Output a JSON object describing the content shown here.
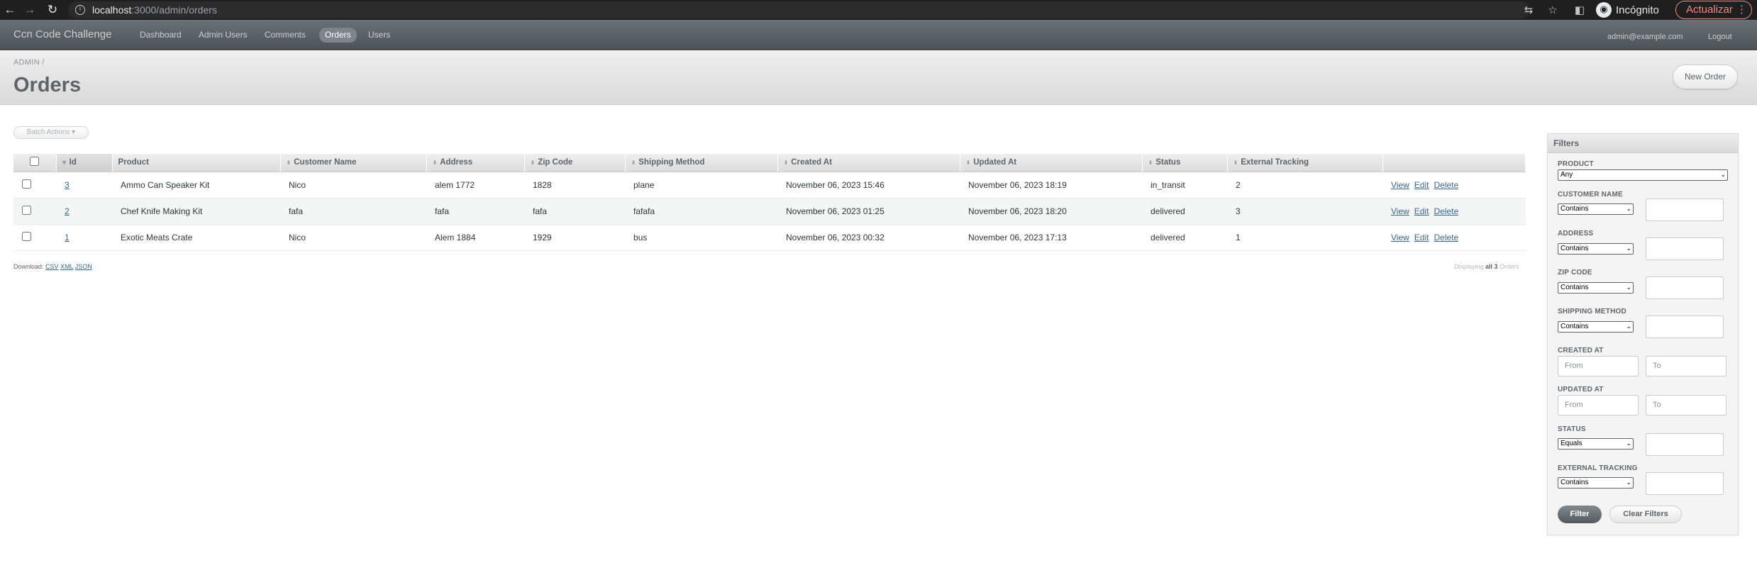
{
  "browser": {
    "url_host": "localhost",
    "url_path": ":3000/admin/orders",
    "incognito_label": "Incógnito",
    "update_label": "Actualizar"
  },
  "header": {
    "site_title": "Ccn Code Challenge",
    "tabs": [
      "Dashboard",
      "Admin Users",
      "Comments",
      "Orders",
      "Users"
    ],
    "current_tab": "Orders",
    "user_email": "admin@example.com",
    "logout_label": "Logout"
  },
  "title_bar": {
    "breadcrumb": "ADMIN",
    "breadcrumb_sep": "/",
    "title": "Orders",
    "action_label": "New Order"
  },
  "batch_actions_label": "Batch Actions",
  "table": {
    "columns": [
      "Id",
      "Product",
      "Customer Name",
      "Address",
      "Zip Code",
      "Shipping Method",
      "Created At",
      "Updated At",
      "Status",
      "External Tracking"
    ],
    "rows": [
      {
        "id": "3",
        "product": "Ammo Can Speaker Kit",
        "customer": "Nico",
        "address": "alem 1772",
        "zip": "1828",
        "shipping": "plane",
        "created": "November 06, 2023 15:46",
        "updated": "November 06, 2023 18:19",
        "status": "in_transit",
        "tracking": "2"
      },
      {
        "id": "2",
        "product": "Chef Knife Making Kit",
        "customer": "fafa",
        "address": "fafa",
        "zip": "fafa",
        "shipping": "fafafa",
        "created": "November 06, 2023 01:25",
        "updated": "November 06, 2023 18:20",
        "status": "delivered",
        "tracking": "3"
      },
      {
        "id": "1",
        "product": "Exotic Meats Crate",
        "customer": "Nico",
        "address": "Alem 1884",
        "zip": "1929",
        "shipping": "bus",
        "created": "November 06, 2023 00:32",
        "updated": "November 06, 2023 17:13",
        "status": "delivered",
        "tracking": "1"
      }
    ],
    "row_actions": [
      "View",
      "Edit",
      "Delete"
    ]
  },
  "footer": {
    "download_label": "Download:",
    "formats": [
      "CSV",
      "XML",
      "JSON"
    ],
    "displaying_prefix": "Displaying",
    "displaying_bold": "all 3",
    "displaying_suffix": "Orders"
  },
  "filters": {
    "title": "Filters",
    "product": {
      "label": "PRODUCT",
      "value": "Any"
    },
    "customer_name": {
      "label": "CUSTOMER NAME",
      "value": "Contains"
    },
    "address": {
      "label": "ADDRESS",
      "value": "Contains"
    },
    "zip_code": {
      "label": "ZIP CODE",
      "value": "Contains"
    },
    "shipping_method": {
      "label": "SHIPPING METHOD",
      "value": "Contains"
    },
    "created_at": {
      "label": "CREATED AT",
      "from": "From",
      "to": "To"
    },
    "updated_at": {
      "label": "UPDATED AT",
      "from": "From",
      "to": "To"
    },
    "status": {
      "label": "STATUS",
      "value": "Equals"
    },
    "external_tracking": {
      "label": "EXTERNAL TRACKING",
      "value": "Contains"
    },
    "filter_label": "Filter",
    "clear_label": "Clear Filters"
  }
}
